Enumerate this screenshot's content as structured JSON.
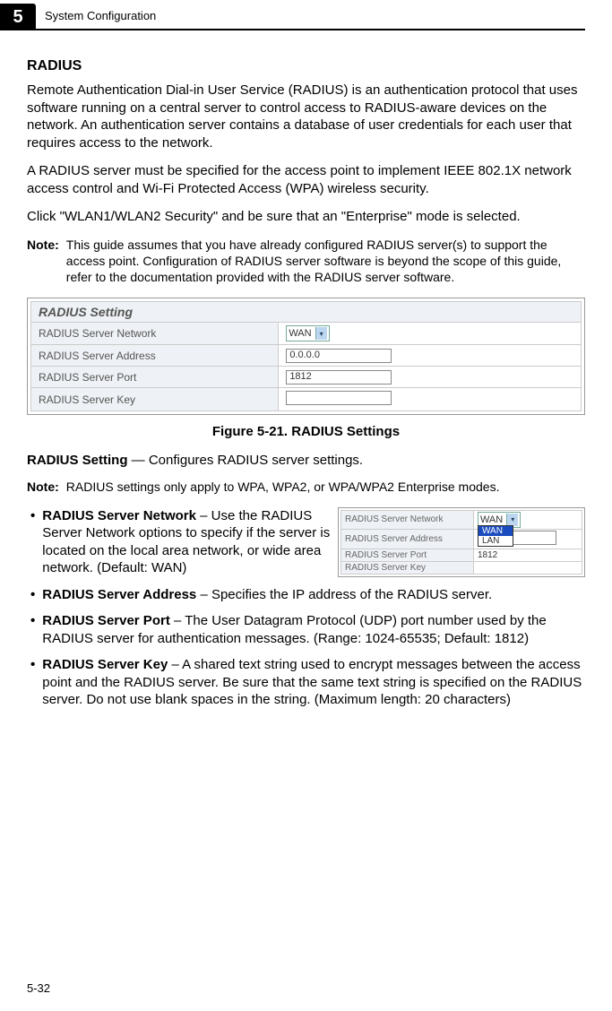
{
  "chapter_num": "5",
  "running_header": "System Configuration",
  "page_number": "5-32",
  "heading": "RADIUS",
  "para1": "Remote Authentication Dial-in User Service (RADIUS) is an authentication protocol that uses software running on a central server to control access to RADIUS-aware devices on the network. An authentication server contains a database of user credentials for each user that requires access to the network.",
  "para2": "A RADIUS server must be specified for the access point to implement IEEE 802.1X network access control and Wi-Fi Protected Access (WPA) wireless security.",
  "para3": "Click \"WLAN1/WLAN2 Security\" and be sure that an \"Enterprise\" mode is selected.",
  "note1_label": "Note:",
  "note1_text": "This guide assumes that you have already configured RADIUS server(s) to support the access point. Configuration of RADIUS server software is beyond the scope of this guide, refer to the documentation provided with the RADIUS server software.",
  "radius_panel": {
    "title": "RADIUS Setting",
    "rows": [
      {
        "label": "RADIUS Server Network",
        "value": "WAN"
      },
      {
        "label": "RADIUS Server Address",
        "value": "0.0.0.0"
      },
      {
        "label": "RADIUS Server Port",
        "value": "1812"
      },
      {
        "label": "RADIUS Server Key",
        "value": ""
      }
    ]
  },
  "figure_caption": "Figure 5-21.   RADIUS Settings",
  "def_heading_bold": "RADIUS Setting",
  "def_heading_rest": " — Configures RADIUS server settings.",
  "note2_label": "Note:",
  "note2_text": "RADIUS settings only apply to WPA, WPA2, or WPA/WPA2 Enterprise modes.",
  "float_panel": {
    "rows": [
      {
        "label": "RADIUS Server Network",
        "value": "WAN"
      },
      {
        "label": "RADIUS Server Address",
        "value": ""
      },
      {
        "label": "RADIUS Server Port",
        "value": "1812"
      },
      {
        "label": "RADIUS Server Key",
        "value": ""
      }
    ],
    "dropdown": {
      "options": [
        "WAN",
        "LAN"
      ],
      "highlighted": "WAN"
    }
  },
  "bullets": [
    {
      "bold": "RADIUS Server Network",
      "rest": " – Use the RADIUS Server Network options to specify if the server is located on the local area network, or wide area network. (Default: WAN)"
    },
    {
      "bold": "RADIUS Server Address",
      "rest": " – Specifies the IP address of the RADIUS server."
    },
    {
      "bold": "RADIUS Server Port",
      "rest": " – The User Datagram Protocol (UDP) port number used by the RADIUS server for authentication messages. (Range: 1024-65535; Default: 1812)"
    },
    {
      "bold": "RADIUS Server Key",
      "rest": " – A shared text string used to encrypt messages between the access point and the RADIUS server. Be sure that the same text string is specified on the RADIUS server. Do not use blank spaces in the string. (Maximum length: 20 characters)"
    }
  ]
}
